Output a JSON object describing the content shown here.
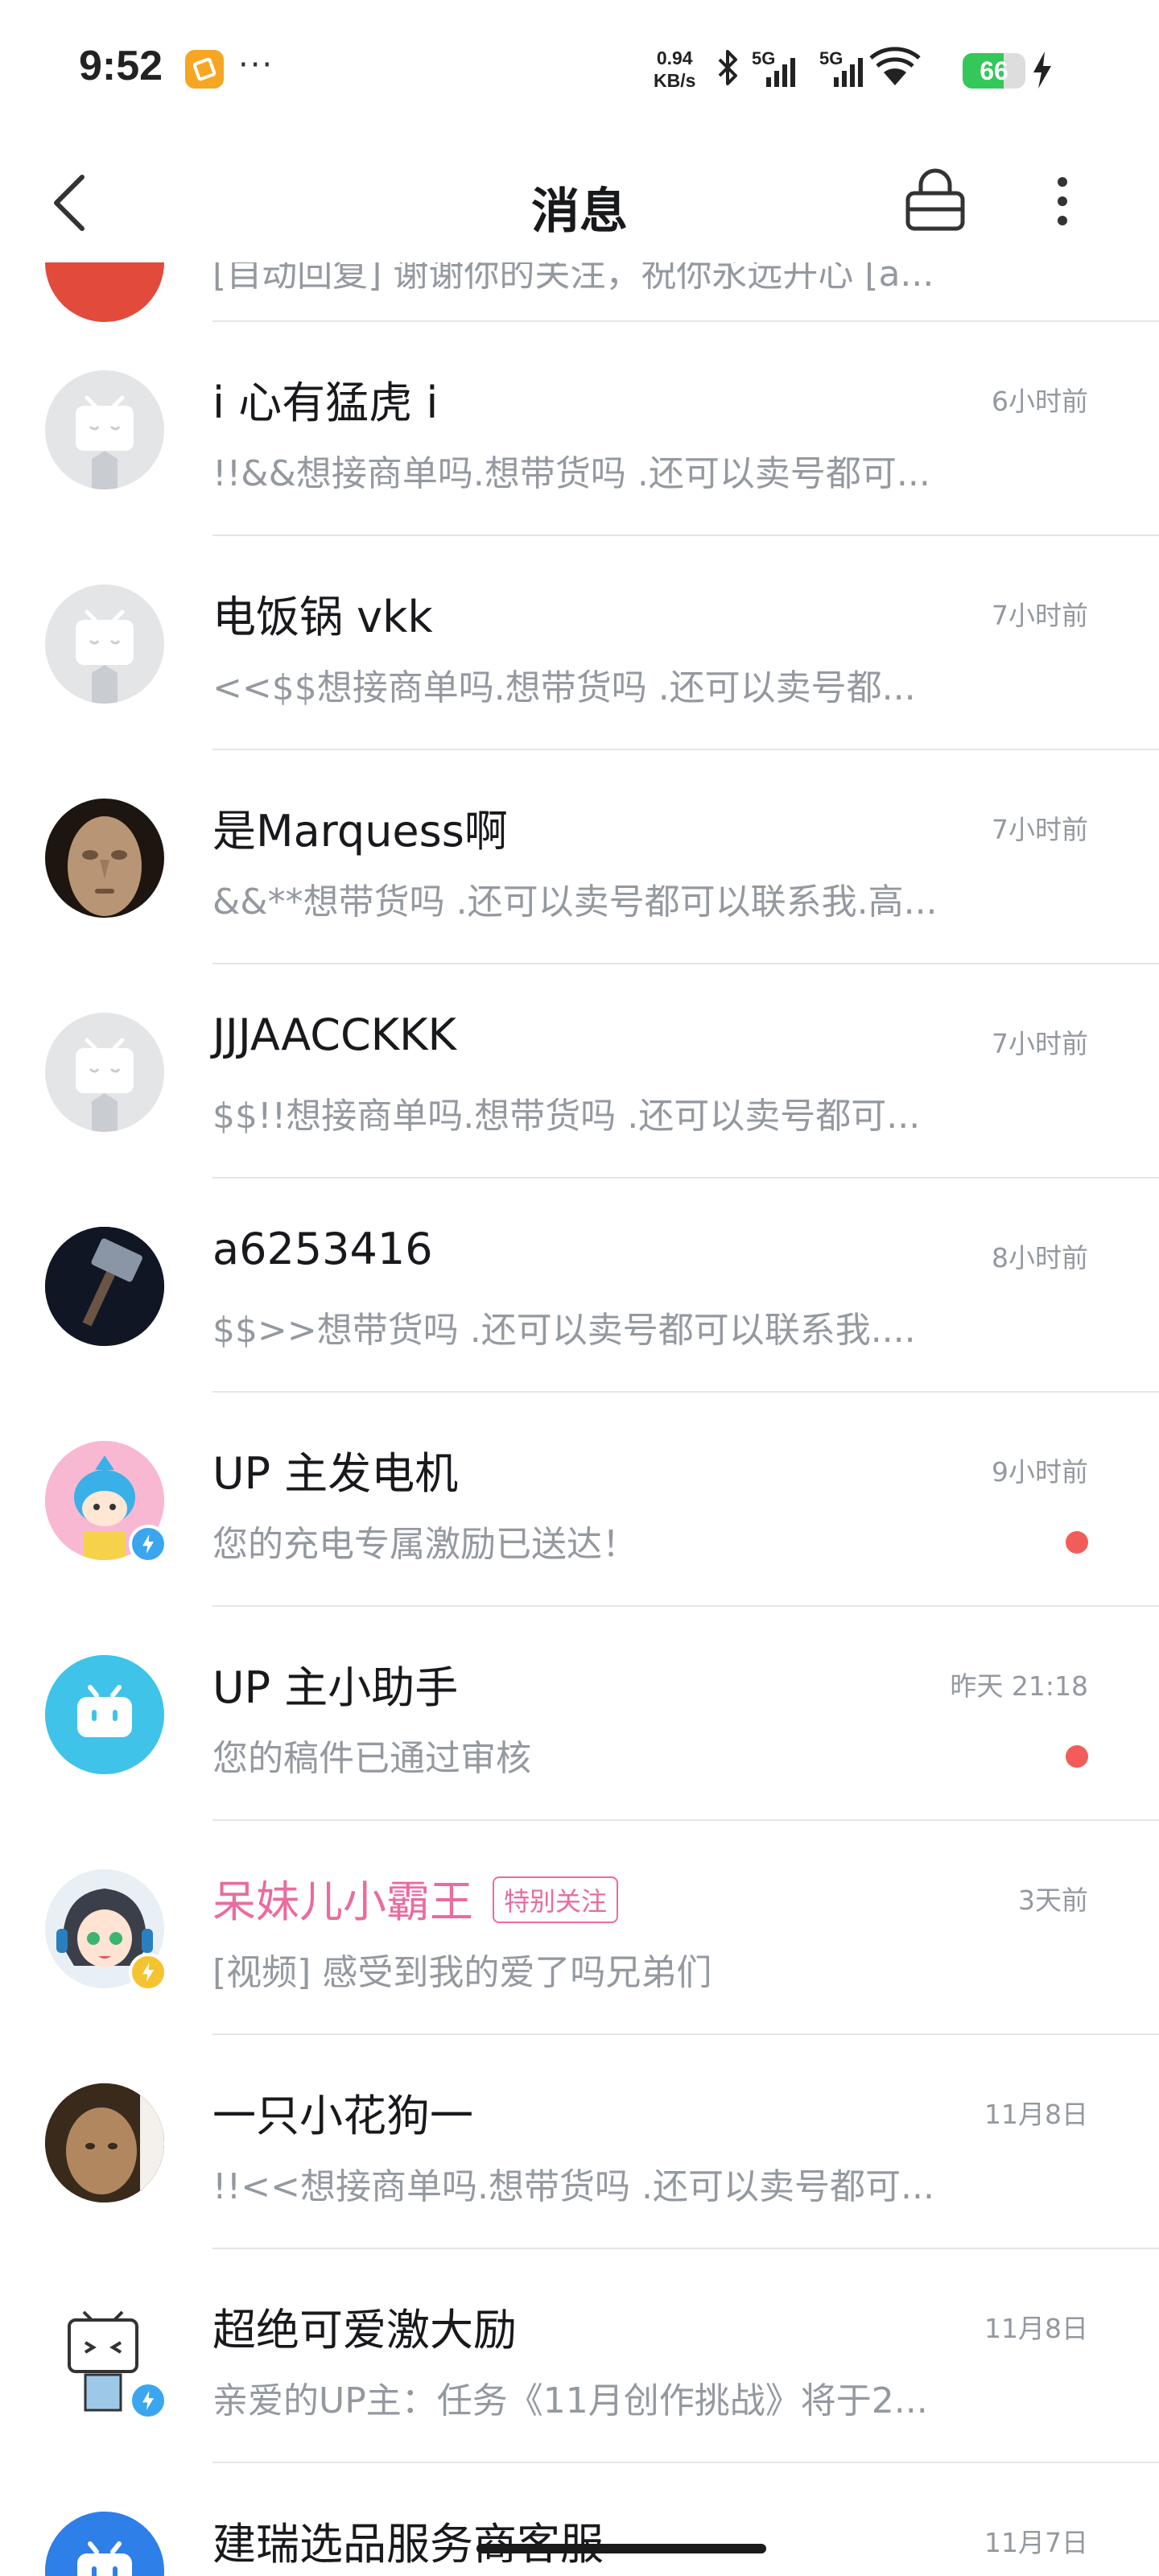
{
  "status_bar": {
    "time": "9:52",
    "dots": "···",
    "speed_value": "0.94",
    "speed_unit": "KB/s",
    "net1": "5G",
    "net2": "5G",
    "battery": "66",
    "battery_level": 0.66
  },
  "nav": {
    "title": "消息"
  },
  "partial_row": {
    "text": "[自动回复] 谢谢你的关注，祝你永远开心 [a..."
  },
  "conversations": [
    {
      "name": "i 心有猛虎 i",
      "time": "6小时前",
      "message": "!!&&想接商单吗.想带货吗 .还可以卖号都可...",
      "unread": false
    },
    {
      "name": "电饭锅 vkk",
      "time": "7小时前",
      "message": "<<$$想接商单吗.想带货吗 .还可以卖号都...",
      "unread": false
    },
    {
      "name": "是Marquess啊",
      "time": "7小时前",
      "message": "&&**想带货吗 .还可以卖号都可以联系我.高...",
      "unread": false
    },
    {
      "name": "JJJAACCKKK",
      "time": "7小时前",
      "message": "$$!!想接商单吗.想带货吗 .还可以卖号都可...",
      "unread": false
    },
    {
      "name": "a6253416",
      "time": "8小时前",
      "message": "$$>>想带货吗 .还可以卖号都可以联系我....",
      "unread": false
    },
    {
      "name": "UP 主发电机",
      "time": "9小时前",
      "message": "您的充电专属激励已送达！",
      "unread": true
    },
    {
      "name": "UP 主小助手",
      "time": "昨天 21:18",
      "message": "您的稿件已通过审核",
      "unread": true
    },
    {
      "name": "呆妹儿小霸王",
      "tag": "特别关注",
      "time": "3天前",
      "message": "[视频] 感受到我的爱了吗兄弟们",
      "unread": false
    },
    {
      "name": "一只小花狗一",
      "time": "11月8日",
      "message": "!!<<想接商单吗.想带货吗 .还可以卖号都可...",
      "unread": false
    },
    {
      "name": "超绝可爱激大励",
      "time": "11月8日",
      "message": "亲爱的UP主：任务《11月创作挑战》将于2...",
      "unread": false
    },
    {
      "name": "建瑞选品服务商客服",
      "time": "11月7日",
      "message": "",
      "unread": false
    }
  ],
  "colors": {
    "accent_pink": "#ea6b9f",
    "unread_dot": "#f25d59",
    "secondary_text": "#9499a0",
    "bilibili_blue": "#3fc3e9"
  }
}
